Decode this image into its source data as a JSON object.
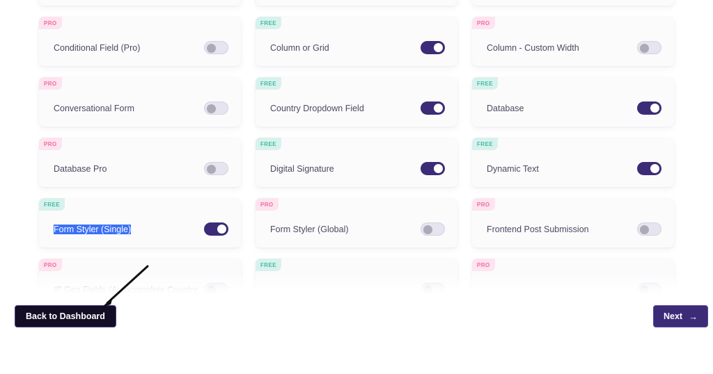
{
  "page": {
    "background_color": "#ffffff",
    "card_background_color": "#fbfbfc"
  },
  "badges": {
    "pro_label": "PRO",
    "free_label": "FREE",
    "pro_bg_color": "#fde4ee",
    "pro_text_color": "#f06aa4",
    "free_bg_color": "#d9f1ec",
    "free_text_color": "#3dbda4"
  },
  "toggle": {
    "on_color": "#3c2b76",
    "off_track_color": "#e6e4ee",
    "off_knob_color": "#adaab8"
  },
  "selection": {
    "highlight_color": "#3a6ff7",
    "highlight_text_color": "#ffffff"
  },
  "modules": {
    "rows": [
      {
        "clipped": "top",
        "cards": [
          {
            "badge": "",
            "label": "",
            "toggle": "on"
          },
          {
            "badge": "",
            "label": "",
            "toggle": "off"
          },
          {
            "badge": "",
            "label": "",
            "toggle": "on"
          }
        ]
      },
      {
        "clipped": "",
        "cards": [
          {
            "badge": "PRO",
            "label": "Conditional Field (Pro)",
            "toggle": "off"
          },
          {
            "badge": "FREE",
            "label": "Column or Grid",
            "toggle": "on"
          },
          {
            "badge": "PRO",
            "label": "Column - Custom Width",
            "toggle": "off"
          }
        ]
      },
      {
        "clipped": "",
        "cards": [
          {
            "badge": "PRO",
            "label": "Conversational Form",
            "toggle": "off"
          },
          {
            "badge": "FREE",
            "label": "Country Dropdown Field",
            "toggle": "on"
          },
          {
            "badge": "FREE",
            "label": "Database",
            "toggle": "on"
          }
        ]
      },
      {
        "clipped": "",
        "cards": [
          {
            "badge": "PRO",
            "label": "Database Pro",
            "toggle": "off"
          },
          {
            "badge": "FREE",
            "label": "Digital Signature",
            "toggle": "on"
          },
          {
            "badge": "FREE",
            "label": "Dynamic Text",
            "toggle": "on"
          }
        ]
      },
      {
        "clipped": "",
        "cards": [
          {
            "badge": "FREE",
            "label": "Form Styler (Single)",
            "toggle": "on",
            "selected": true
          },
          {
            "badge": "PRO",
            "label": "Form Styler (Global)",
            "toggle": "off"
          },
          {
            "badge": "PRO",
            "label": "Frontend Post Submission",
            "toggle": "off"
          }
        ]
      },
      {
        "clipped": "bottom",
        "cards": [
          {
            "badge": "PRO",
            "label": "IP Geo Fields (Autocomplete Country",
            "toggle": "off"
          },
          {
            "badge": "FREE",
            "label": "",
            "toggle": "off"
          },
          {
            "badge": "PRO",
            "label": "",
            "toggle": "off"
          }
        ]
      }
    ]
  },
  "footer": {
    "back_label": "Back to Dashboard",
    "back_bg_color": "#140d26",
    "next_label": "Next",
    "next_arrow": "→",
    "next_bg_color": "#3c2b76"
  }
}
